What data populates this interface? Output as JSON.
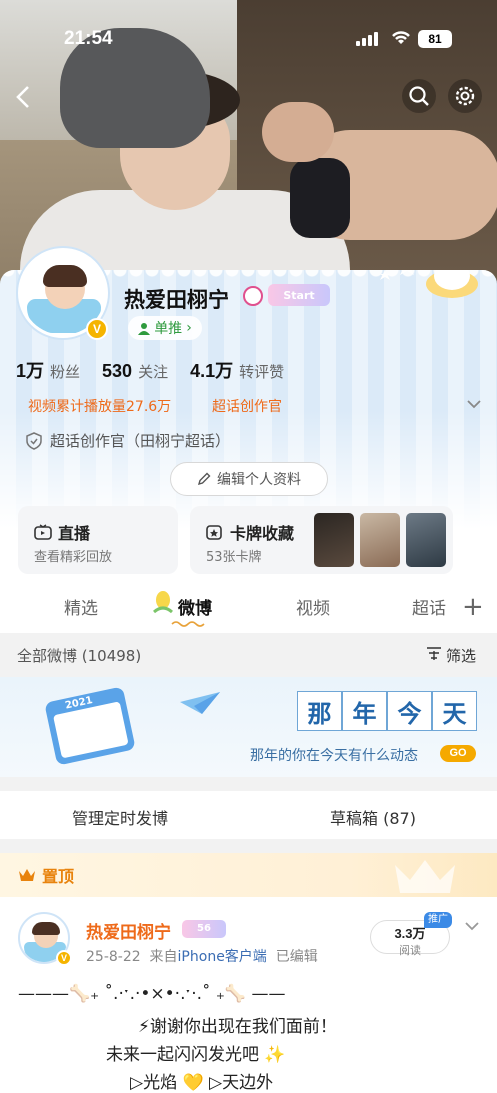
{
  "status": {
    "time": "21:54",
    "battery": "81"
  },
  "profile": {
    "name": "热爱田栩宁",
    "level_badge": "Start",
    "recommend": "单推",
    "stats": [
      {
        "value": "1万",
        "label": "粉丝"
      },
      {
        "value": "530",
        "label": "关注"
      },
      {
        "value": "4.1万",
        "label": "转评赞"
      }
    ],
    "tags": [
      "视频累计播放量27.6万",
      "超话创作官"
    ],
    "super_title": "超话创作官（田栩宁超话）",
    "edit_button": "编辑个人资料"
  },
  "tiles": {
    "live": {
      "title": "直播",
      "sub": "查看精彩回放"
    },
    "cards": {
      "title": "卡牌收藏",
      "sub": "53张卡牌"
    }
  },
  "tabs": [
    "精选",
    "微博",
    "视频",
    "超话"
  ],
  "active_tab": "微博",
  "posts_bar": {
    "count": "全部微博 (10498)",
    "filter": "筛选"
  },
  "banner": {
    "chars": [
      "那",
      "年",
      "今",
      "天"
    ],
    "sub": "那年的你在今天有什么动态",
    "go": "GO",
    "year": "2021"
  },
  "actions": {
    "scheduled": "管理定时发博",
    "drafts": "草稿箱 (87)"
  },
  "pinned": {
    "label": "置顶"
  },
  "post": {
    "name": "热爱田栩宁",
    "level": "56",
    "date": "25-8-22",
    "from": "来自",
    "source": "iPhone客户端",
    "edited": "已编辑",
    "reads_value": "3.3万",
    "reads_label": "阅读",
    "promo": "推广",
    "lines": [
      "———🦴₊ ˚.·ˑ.·•×•·.ˑ·.˚ ₊🦴 ——",
      "⚡谢谢你出现在我们面前！",
      "未来一起闪闪发光吧 ✨",
      "▷光焰 💛 ▷天边外"
    ]
  },
  "colors": {
    "accent": "#ee6a1a",
    "link": "#3b6db3",
    "gold": "#f5b400"
  }
}
